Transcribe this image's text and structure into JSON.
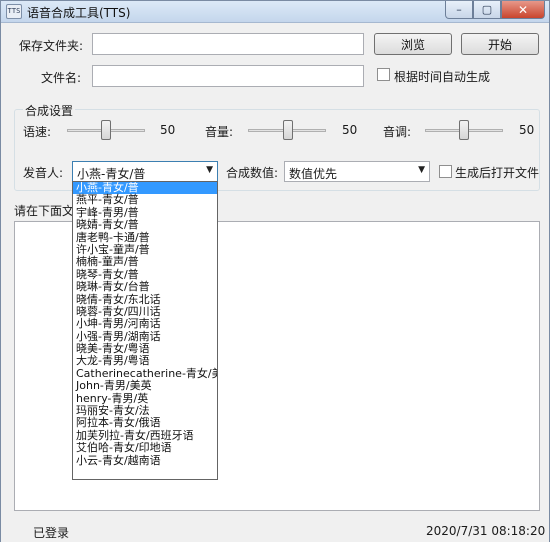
{
  "window": {
    "title": "语音合成工具(TTS)",
    "app_icon": "TTS",
    "minimize": "–",
    "maximize": "▢",
    "close": "✕"
  },
  "form": {
    "save_folder_label": "保存文件夹:",
    "save_folder_value": "",
    "browse_label": "浏览",
    "start_label": "开始",
    "filename_label": "文件名:",
    "filename_value": "",
    "auto_name_label": "根据时间自动生成"
  },
  "settings": {
    "group_title": "合成设置",
    "speed_label": "语速:",
    "speed_value": "50",
    "volume_label": "音量:",
    "volume_value": "50",
    "pitch_label": "音调:",
    "pitch_value": "50",
    "speaker_label": "发音人:",
    "speaker_selected": "小燕-青女/普",
    "param_label": "合成数值:",
    "param_selected": "数值优先",
    "open_after_label": "生成后打开文件"
  },
  "speaker_options": [
    "小燕-青女/普",
    "燕平-青女/普",
    "宇峰-青男/普",
    "晓婧-青女/普",
    "唐老鸭-卡通/普",
    "许小宝-童声/普",
    "楠楠-童声/普",
    "晓琴-青女/普",
    "晓琳-青女/台普",
    "晓倩-青女/东北话",
    "晓蓉-青女/四川话",
    "小坤-青男/河南话",
    "小强-青男/湖南话",
    "晓美-青女/粤语",
    "大龙-青男/粤语",
    "Catherinecatherine-青女/美英",
    "John-青男/美英",
    "henry-青男/英",
    "玛丽安-青女/法",
    "阿拉本-青女/俄语",
    "加芙列拉-青女/西班牙语",
    "艾伯哈-青女/印地语",
    "小云-青女/越南语"
  ],
  "text_input": {
    "prompt_label": "请在下面文字",
    "value": ""
  },
  "status": {
    "login": "已登录",
    "datetime": "2020/7/31 08:18:20"
  }
}
